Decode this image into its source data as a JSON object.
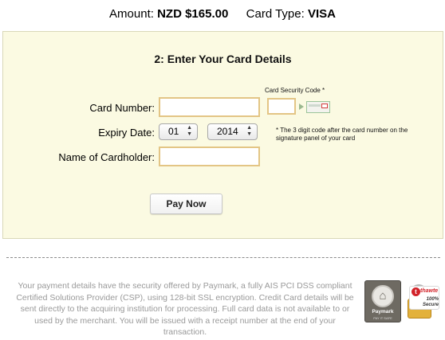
{
  "summary": {
    "amount_label": "Amount:",
    "amount_value": "NZD $165.00",
    "card_type_label": "Card Type:",
    "card_type_value": "VISA"
  },
  "form": {
    "title": "2: Enter Your Card Details",
    "card_number_label": "Card Number:",
    "card_number_value": "",
    "expiry_label": "Expiry Date:",
    "expiry_month": "01",
    "expiry_year": "2014",
    "cardholder_label": "Name of Cardholder:",
    "cardholder_value": "",
    "csc_label": "Card Security Code *",
    "csc_value": "",
    "csc_note": "* The 3 digit code after the card number on the signature panel of your card",
    "pay_button": "Pay Now"
  },
  "footer": {
    "security_text": "Your payment details have the security offered by Paymark, a fully AIS PCI DSS compliant Certified Solutions Provider (CSP), using 128-bit SSL encryption. Credit Card details will be sent directly to the acquiring institution for processing. Full card data is not available to or used by the merchant. You will be issued with a receipt number at the end of your transaction.",
    "paymark_name": "Paymark",
    "paymark_tagline": "PAY IT SAFE",
    "thawte_name": "thawte",
    "thawte_secure": "100% Secure"
  },
  "icons": {
    "select_arrows": "up-down-chevron-icon",
    "csc_arrow": "arrow-right-icon",
    "csc_card": "card-back-icon"
  },
  "colors": {
    "panel_background": "#fbfae2",
    "input_border": "#e3c585",
    "muted_text": "#999999"
  }
}
